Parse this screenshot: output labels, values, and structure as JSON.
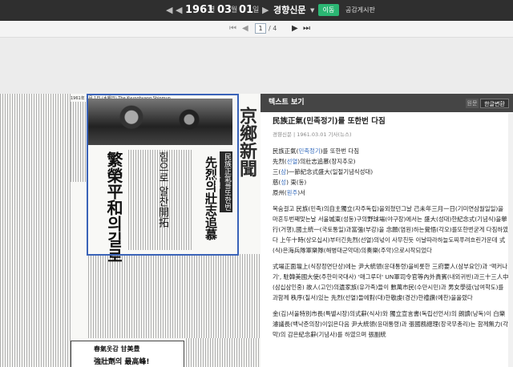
{
  "topbar": {
    "year": "1961",
    "year_unit": "년",
    "month": "03",
    "month_unit": "월",
    "day": "01",
    "day_unit": "일",
    "paper": "경향신문",
    "move_label": "이동",
    "board_label": "공감게시판"
  },
  "pager": {
    "current": "1",
    "total": "/ 4"
  },
  "newspaper": {
    "header_line": "1961年 3月 1日  (水曜日)    The Kyunghyang Shinmun",
    "headline_1": "繁榮平和의길로",
    "headline_2": "先烈의壯志追慕",
    "headline_3": "힘으로 알찬開拓",
    "banner": "民族正氣를또한번다짐",
    "masthead": "京鄉新聞",
    "ad_1": "春氣옷감 甘美豊",
    "ad_2": "強壯劑의 最高峰!"
  },
  "panel": {
    "title": "텍스트 보기",
    "orig_btn": "원문",
    "kor_btn": "한글변환",
    "article_title": "民族正氣(민족정기)를 또한번 다짐",
    "meta": "경향신문 | 1961.03.01 기사(뉴스)",
    "intro": [
      {
        "a": "民族正氣(",
        "b": "민족정기",
        "c": ")를 또한번 다짐"
      },
      {
        "a": "先烈(",
        "b": "선열",
        "c": ")의壯志追慕(장지추모)"
      },
      {
        "a": "三(",
        "b": "삼",
        "c": ")一節紀念式盛大(일절기념식성대)"
      },
      {
        "a": "慈(",
        "b": "성",
        "c": ") 東(동)"
      },
      {
        "a": "原州(",
        "b": "원주",
        "c": ")서"
      }
    ],
    "p1": "목숨걸고 民族(민족)의自主獨立(자주독립)을외쳤던그날 己未年三月一日(기미연삼월일일)을 마흔두번째맞는날 서울城東(성동)구의野球場(야구장)에서는 盛大(성대)한紀念式(기념식)을擧行(거행),國土統一(국토통일)과富強(부강)을 念願(염원)하는覺悟(각오)를또한번굳게 다짐하였다 上午十時(상오십시)부터긴先烈(선열)의넋이 사무친듯 이날따라하늘도찌푸려흐린가운데 式(식)은海兵隊軍樂隊(해병대군악대)의奏樂(주악)으로시작되었다",
    "p2": "式場正面壇上(식장정면단상)에는 尹大統領(윤대통령)을비롯한 三府要人(삼부요인)과 '맥커나기', 駐韓美國大使(주한미국대사) '매그루더' UN軍司令官等內外貴賓(내외귀빈)과三十三人中(삼십삼인중) 故人(고인)의遺家族(유가족)들이 數萬市民(수만시민)과 男女學徒(남여학도)를 과함께 秩序(질서)있는 先烈(선열)들에對(대)한敬虔(경건)한禮讚(예찬)을올렸다",
    "p3": "金(김)서울特別市長(특별시장)의式辭(식사)와 獨立宣言書(독립선언서)의 朗讀(낭독)이 白樂濬議長(백낙준의장)이읽은다음 尹大統領(윤대통령)과 張國務總理(장국무총리)는 함께無力(각막)의 감은紀念辭(기념사)를 하였으며 張副統"
  }
}
